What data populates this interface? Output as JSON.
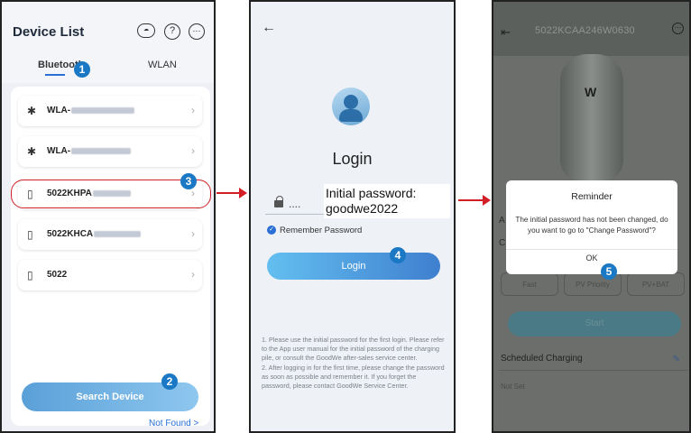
{
  "screen1": {
    "title": "Device List",
    "header_icons": {
      "cloud": "cloud-icon",
      "help": "?",
      "more": "⋯"
    },
    "tabs": [
      {
        "label": "Bluetooth"
      },
      {
        "label": "WLAN"
      }
    ],
    "devices": [
      {
        "name": "WLA-",
        "type": "bluetooth"
      },
      {
        "name": "WLA-",
        "type": "bluetooth"
      },
      {
        "name": "5022KHPA",
        "type": "charger"
      },
      {
        "name": "5022KHCA",
        "type": "charger"
      },
      {
        "name": "5022",
        "type": "charger"
      }
    ],
    "search_button": "Search Device",
    "not_found_link": "Not Found >"
  },
  "screen2": {
    "title": "Login",
    "password_mask": "....",
    "password_hint_line1": "Initial password:",
    "password_hint_line2": "goodwe2022",
    "remember_label": "Remember Password",
    "login_button": "Login",
    "notes": [
      "1. Please use the initial password for the first login. Please refer to the App user manual for the initial password of the charging pile, or consult the GoodWe after-sales service center.",
      "2. After logging in for the first time, please change the password as soon as possible and remember it. If you forget the password, please contact GoodWe Service Center."
    ]
  },
  "screen3": {
    "device_code": "5022KCAA246W0630",
    "modes": [
      "Fast",
      "PV Priority",
      "PV+BAT"
    ],
    "start_button": "Start",
    "side_label_a": "A",
    "side_label_c": "C",
    "scheduled_title": "Scheduled Charging",
    "scheduled_value": "Not Set",
    "dialog": {
      "title": "Reminder",
      "message": "The initial password has not been changed, do you want to go to \"Change Password\"?",
      "ok": "OK"
    }
  },
  "steps": [
    "1",
    "2",
    "3",
    "4",
    "5"
  ],
  "colors": {
    "step_badge": "#1a78c4",
    "highlight": "#d02027",
    "arrow": "#d21f26",
    "link": "#2a6fd6"
  }
}
